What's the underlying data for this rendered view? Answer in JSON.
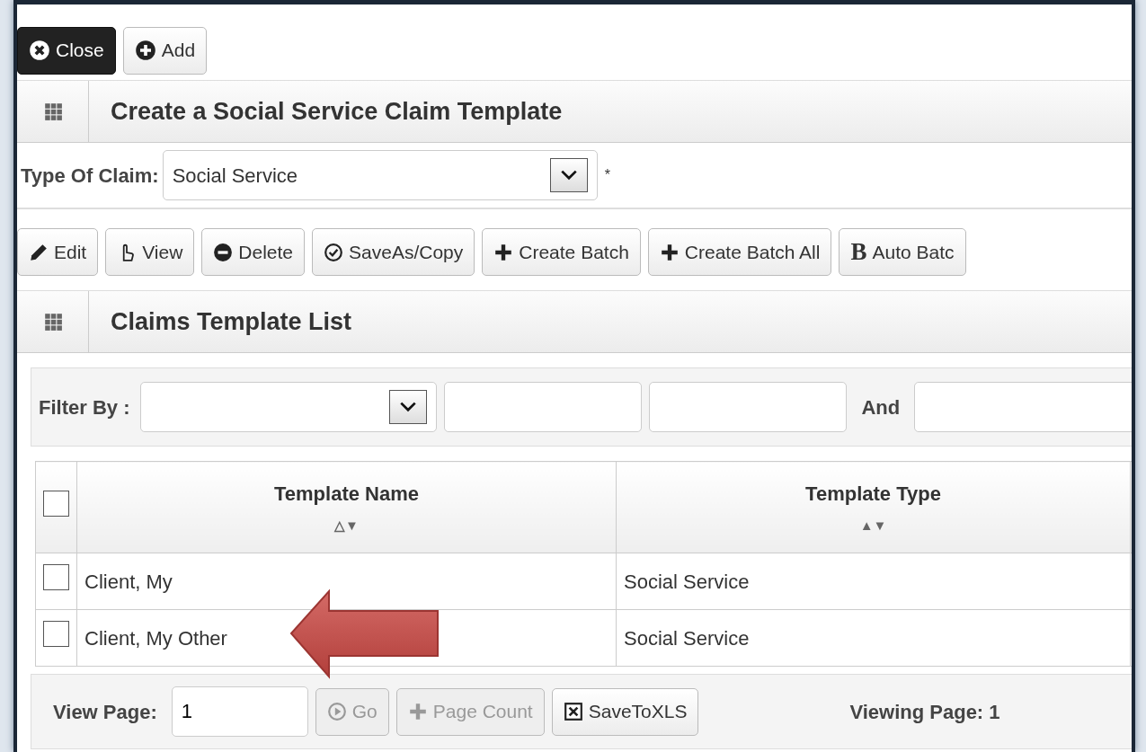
{
  "toolbar": [
    {
      "label": "Close",
      "kind": "dark"
    },
    {
      "label": "Add",
      "kind": "light"
    }
  ],
  "form_header": {
    "title": "Create a Social Service Claim Template"
  },
  "type_of_claim": {
    "label": "Type Of Claim:",
    "value": "Social Service",
    "required_mark": "*"
  },
  "actions": [
    {
      "label": "Edit"
    },
    {
      "label": "View"
    },
    {
      "label": "Delete"
    },
    {
      "label": "SaveAs/Copy"
    },
    {
      "label": "Create Batch"
    },
    {
      "label": "Create Batch All"
    },
    {
      "label": "Auto Batc",
      "glyph": "B"
    }
  ],
  "list_header": {
    "title": "Claims Template List"
  },
  "filter": {
    "label": "Filter By :",
    "and_label": "And"
  },
  "table": {
    "header_checked": false,
    "columns": [
      {
        "label": "Template Name",
        "sort": "△▼"
      },
      {
        "label": "Template Type",
        "sort": "▲▼"
      }
    ],
    "rows": [
      {
        "checked": false,
        "cells": [
          "Client, My",
          "Social Service"
        ]
      },
      {
        "checked": false,
        "cells": [
          "Client, My Other",
          "Social Service"
        ]
      }
    ]
  },
  "pager": {
    "label": "View Page:",
    "value": "1",
    "buttons": [
      {
        "label": "Go",
        "disabled": true
      },
      {
        "label": "Page Count",
        "disabled": true
      },
      {
        "label": "SaveToXLS",
        "disabled": false
      }
    ],
    "status": "Viewing Page: 1"
  }
}
